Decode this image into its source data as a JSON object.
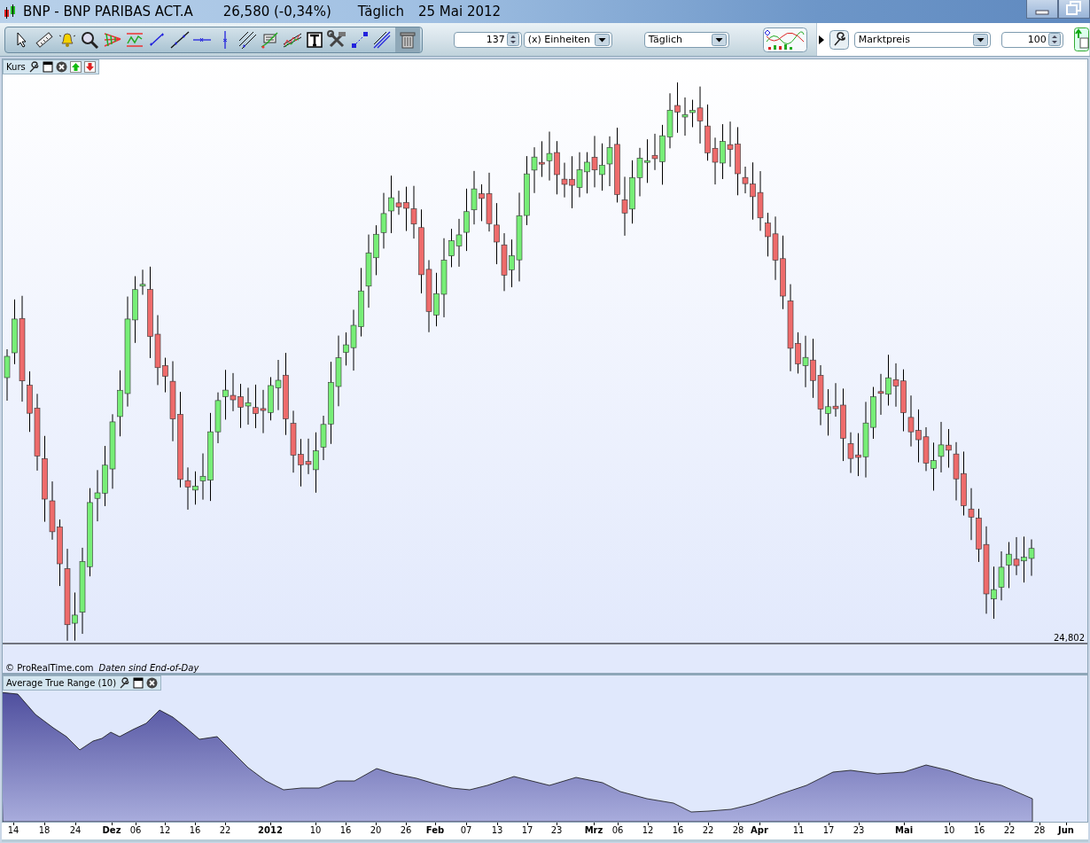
{
  "window": {
    "title": "BNP - BNP PARIBAS ACT.A",
    "price": "26,580 (-0,34%)",
    "interval": "Täglich",
    "date": "25 Mai 2012"
  },
  "toolbar": {
    "units_value": "137",
    "units_dropdown": "(x) Einheiten",
    "period_dropdown": "Täglich",
    "price_dropdown": "Marktpreis",
    "amount_value": "100"
  },
  "price_panel": {
    "label": "Kurs",
    "last_price": "24,802",
    "copyright": "© ProRealTime.com",
    "note": "Daten sind End-of-Day"
  },
  "indicator_panel": {
    "label": "Average True Range (10)"
  },
  "x_axis": {
    "ticks": [
      {
        "label": "14",
        "kind": "day"
      },
      {
        "label": "18",
        "kind": "day"
      },
      {
        "label": "24",
        "kind": "day"
      },
      {
        "label": "Dez",
        "kind": "month"
      },
      {
        "label": "06",
        "kind": "day"
      },
      {
        "label": "12",
        "kind": "day"
      },
      {
        "label": "16",
        "kind": "day"
      },
      {
        "label": "22",
        "kind": "day"
      },
      {
        "label": "2012",
        "kind": "month"
      },
      {
        "label": "10",
        "kind": "day"
      },
      {
        "label": "16",
        "kind": "day"
      },
      {
        "label": "20",
        "kind": "day"
      },
      {
        "label": "26",
        "kind": "day"
      },
      {
        "label": "Feb",
        "kind": "month"
      },
      {
        "label": "07",
        "kind": "day"
      },
      {
        "label": "13",
        "kind": "day"
      },
      {
        "label": "17",
        "kind": "day"
      },
      {
        "label": "23",
        "kind": "day"
      },
      {
        "label": "Mrz",
        "kind": "month"
      },
      {
        "label": "06",
        "kind": "day"
      },
      {
        "label": "12",
        "kind": "day"
      },
      {
        "label": "16",
        "kind": "day"
      },
      {
        "label": "22",
        "kind": "day"
      },
      {
        "label": "28",
        "kind": "day"
      },
      {
        "label": "Apr",
        "kind": "month"
      },
      {
        "label": "11",
        "kind": "day"
      },
      {
        "label": "17",
        "kind": "day"
      },
      {
        "label": "23",
        "kind": "day"
      },
      {
        "label": "Mai",
        "kind": "month"
      },
      {
        "label": "10",
        "kind": "day"
      },
      {
        "label": "16",
        "kind": "day"
      },
      {
        "label": "22",
        "kind": "day"
      },
      {
        "label": "28",
        "kind": "day"
      },
      {
        "label": "Jun",
        "kind": "month"
      }
    ]
  }
}
